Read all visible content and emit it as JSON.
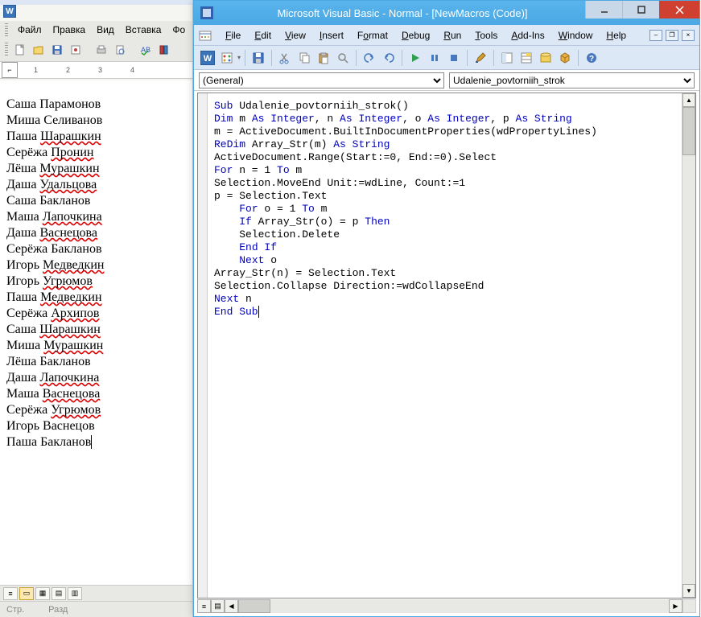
{
  "word": {
    "menu": {
      "file": "Файл",
      "edit": "Правка",
      "view": "Вид",
      "insert": "Вставка",
      "format_cut": "Фо"
    },
    "ruler_nums": [
      "1",
      "2",
      "3",
      "4"
    ],
    "names": [
      "Саша Парамонов",
      "Миша Селиванов",
      "Паша Шарашкин",
      "Серёжа Пронин",
      "Лёша Мурашкин",
      "Даша Удальцова",
      "Саша Бакланов",
      "Маша Лапочкина",
      "Даша Васнецова",
      "Серёжа Бакланов",
      "Игорь Медведкин",
      "Игорь Угрюмов",
      "Паша Медведкин",
      "Серёжа Архипов",
      "Саша Шарашкин",
      "Миша Мурашкин",
      "Лёша Бакланов",
      "Даша Лапочкина",
      "Маша Васнецова",
      "Серёжа Угрюмов",
      "Игорь Васнецов",
      "Паша Бакланов"
    ],
    "status": {
      "page": "Стр.",
      "section": "Разд"
    }
  },
  "vb": {
    "title": "Microsoft Visual Basic - Normal - [NewMacros (Code)]",
    "menu": {
      "file": "File",
      "edit": "Edit",
      "view": "View",
      "insert": "Insert",
      "format": "Format",
      "debug": "Debug",
      "run": "Run",
      "tools": "Tools",
      "addins": "Add-Ins",
      "window": "Window",
      "help": "Help"
    },
    "dropdown_left": "(General)",
    "dropdown_right": "Udalenie_povtorniih_strok",
    "code_tokens": [
      [
        [
          "kw",
          "Sub"
        ],
        [
          "",
          " Udalenie_povtorniih_strok()"
        ]
      ],
      [
        [
          "kw",
          "Dim"
        ],
        [
          "",
          " m "
        ],
        [
          "kw",
          "As Integer"
        ],
        [
          "",
          ", n "
        ],
        [
          "kw",
          "As Integer"
        ],
        [
          "",
          ", o "
        ],
        [
          "kw",
          "As Integer"
        ],
        [
          "",
          ", p "
        ],
        [
          "kw",
          "As String"
        ]
      ],
      [
        [
          "",
          "m = ActiveDocument.BuiltInDocumentProperties(wdPropertyLines)"
        ]
      ],
      [
        [
          "kw",
          "ReDim"
        ],
        [
          "",
          " Array_Str(m) "
        ],
        [
          "kw",
          "As String"
        ]
      ],
      [
        [
          "",
          "ActiveDocument.Range(Start:=0, End:=0).Select"
        ]
      ],
      [
        [
          "kw",
          "For"
        ],
        [
          "",
          " n = 1 "
        ],
        [
          "kw",
          "To"
        ],
        [
          "",
          " m"
        ]
      ],
      [
        [
          "",
          "Selection.MoveEnd Unit:=wdLine, Count:=1"
        ]
      ],
      [
        [
          "",
          "p = Selection.Text"
        ]
      ],
      [
        [
          "",
          "    "
        ],
        [
          "kw",
          "For"
        ],
        [
          "",
          " o = 1 "
        ],
        [
          "kw",
          "To"
        ],
        [
          "",
          " m"
        ]
      ],
      [
        [
          "",
          "    "
        ],
        [
          "kw",
          "If"
        ],
        [
          "",
          " Array_Str(o) = p "
        ],
        [
          "kw",
          "Then"
        ]
      ],
      [
        [
          "",
          "    Selection.Delete"
        ]
      ],
      [
        [
          "",
          "    "
        ],
        [
          "kw",
          "End If"
        ]
      ],
      [
        [
          "",
          "    "
        ],
        [
          "kw",
          "Next"
        ],
        [
          "",
          " o"
        ]
      ],
      [
        [
          "",
          "Array_Str(n) = Selection.Text"
        ]
      ],
      [
        [
          "",
          "Selection.Collapse Direction:=wdCollapseEnd"
        ]
      ],
      [
        [
          "kw",
          "Next"
        ],
        [
          "",
          " n"
        ]
      ],
      [
        [
          "kw",
          "End Sub"
        ]
      ]
    ]
  }
}
